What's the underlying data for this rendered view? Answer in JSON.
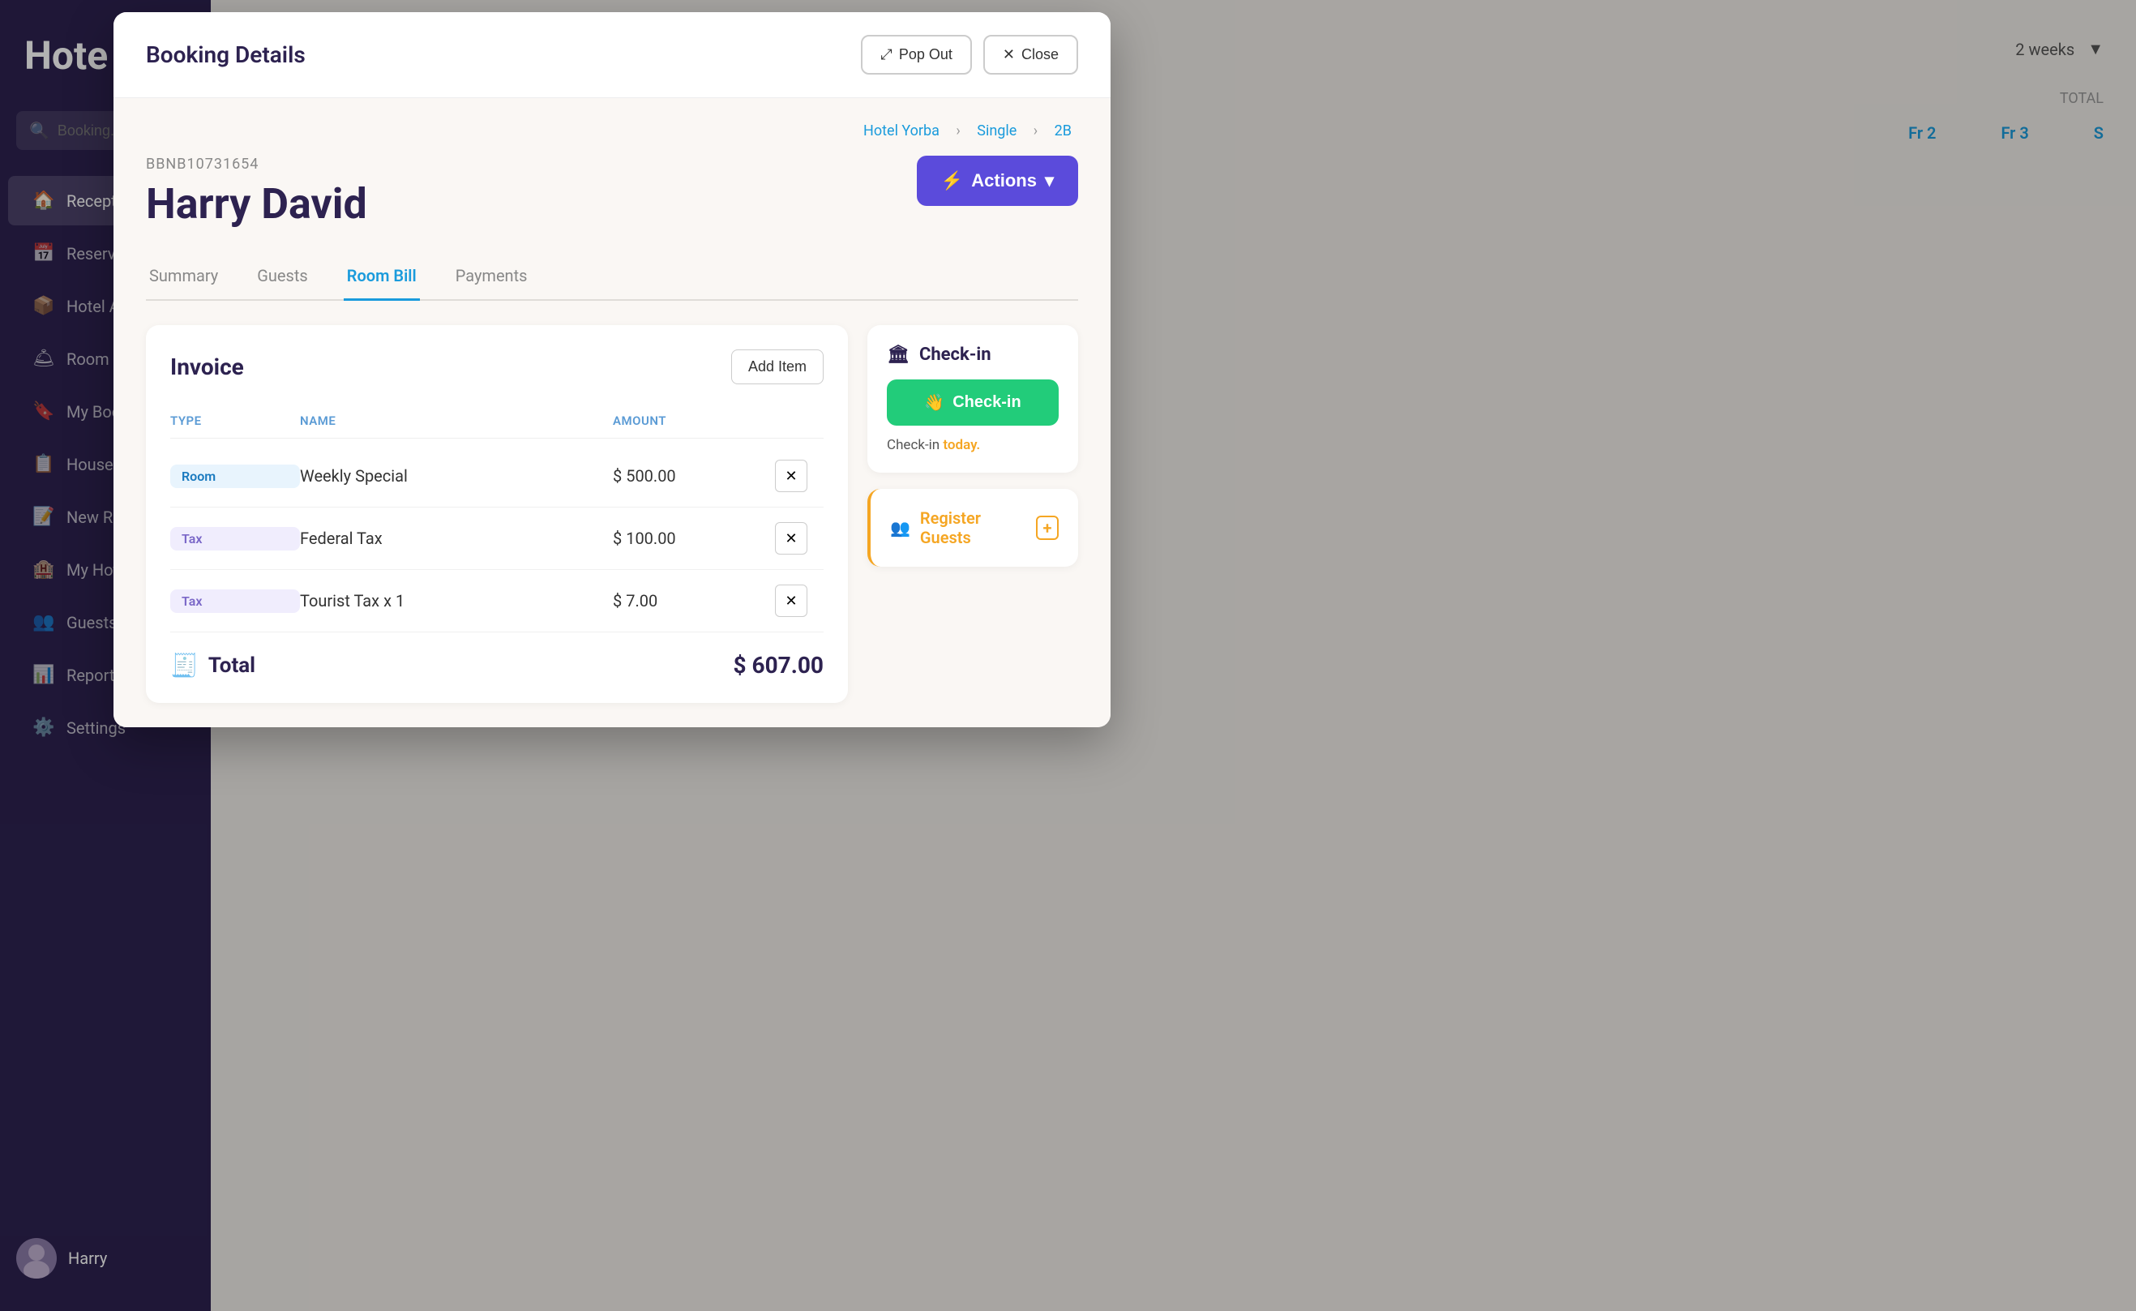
{
  "sidebar": {
    "logo": "Hote",
    "search_placeholder": "Booking...",
    "items": [
      {
        "id": "reception",
        "label": "Reception",
        "icon": "🏠",
        "active": true
      },
      {
        "id": "reservations",
        "label": "Reservations",
        "icon": "📅"
      },
      {
        "id": "hotel-activity",
        "label": "Hotel Activity",
        "icon": "📦"
      },
      {
        "id": "room-services",
        "label": "Room Services",
        "icon": "🛎"
      },
      {
        "id": "my-booking",
        "label": "My Booking",
        "icon": "🔖"
      },
      {
        "id": "housekeeping",
        "label": "Housekeeping",
        "icon": "📋"
      },
      {
        "id": "new-reserva",
        "label": "New Reserva...",
        "icon": "📝"
      },
      {
        "id": "my-hotel",
        "label": "My Hotel",
        "icon": "🏨"
      },
      {
        "id": "guests",
        "label": "Guests",
        "icon": "👥"
      },
      {
        "id": "reports",
        "label": "Reports",
        "icon": "📊"
      },
      {
        "id": "settings",
        "label": "Settings",
        "icon": "⚙️"
      }
    ],
    "user": {
      "name": "Harry"
    }
  },
  "modal": {
    "title": "Booking Details",
    "pop_out_label": "Pop Out",
    "close_label": "Close",
    "breadcrumb": {
      "hotel": "Hotel Yorba",
      "type": "Single",
      "room": "2B",
      "separator": "›"
    },
    "booking_id": "BBNB10731654",
    "booking_name": "Harry David",
    "actions_label": "Actions",
    "tabs": [
      {
        "id": "summary",
        "label": "Summary"
      },
      {
        "id": "guests",
        "label": "Guests"
      },
      {
        "id": "room-bill",
        "label": "Room Bill",
        "active": true
      },
      {
        "id": "payments",
        "label": "Payments"
      }
    ],
    "invoice": {
      "title": "Invoice",
      "add_item_label": "Add Item",
      "columns": {
        "type": "TYPE",
        "name": "NAME",
        "amount": "AMOUNT"
      },
      "rows": [
        {
          "type": "Room",
          "type_class": "room",
          "name": "Weekly Special",
          "amount": "$ 500.00"
        },
        {
          "type": "Tax",
          "type_class": "tax",
          "name": "Federal Tax",
          "amount": "$ 100.00"
        },
        {
          "type": "Tax",
          "type_class": "tax",
          "name": "Tourist Tax x 1",
          "amount": "$ 7.00"
        }
      ],
      "total_label": "Total",
      "total_amount": "$ 607.00"
    },
    "checkin_panel": {
      "title": "Check-in",
      "button_label": "Check-in",
      "note_prefix": "Check-in ",
      "note_highlight": "today.",
      "register_label": "Register Guests"
    }
  },
  "background": {
    "title": "Hote",
    "schedule_period": "2 weeks"
  }
}
